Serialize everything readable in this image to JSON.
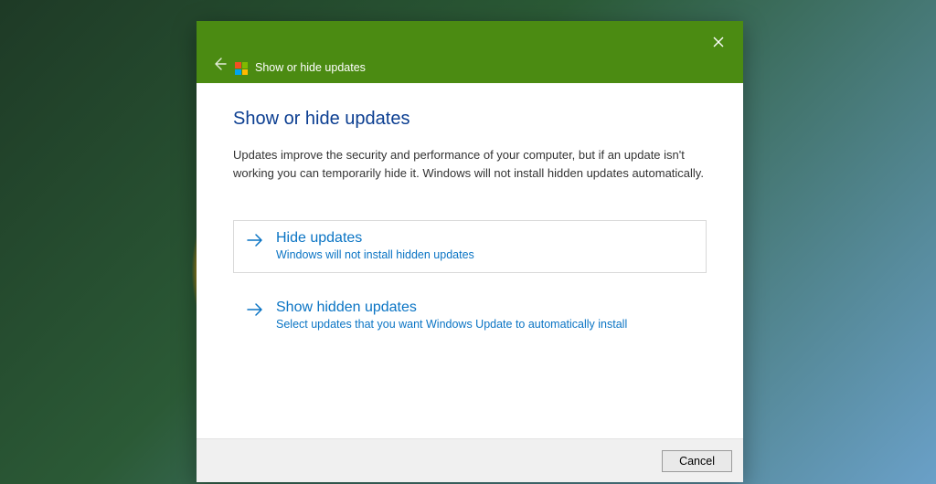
{
  "window": {
    "title": "Show or hide updates"
  },
  "content": {
    "heading": "Show or hide updates",
    "description": "Updates improve the security and performance of your computer, but if an update isn't working you can temporarily hide it. Windows will not install hidden updates automatically."
  },
  "options": {
    "hide": {
      "title": "Hide updates",
      "subtitle": "Windows will not install hidden updates"
    },
    "show": {
      "title": "Show hidden updates",
      "subtitle": "Select updates that you want Windows Update to automatically install"
    }
  },
  "footer": {
    "cancel": "Cancel"
  }
}
